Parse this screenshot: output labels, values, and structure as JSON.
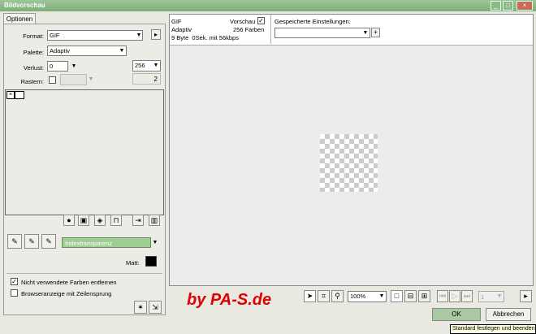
{
  "window": {
    "title": "Bildvorschau",
    "controls": [
      "minimize-icon",
      "maximize-icon",
      "close-icon"
    ]
  },
  "tabs": [
    {
      "label": "Optionen"
    }
  ],
  "options": {
    "format_label": "Format:",
    "format_value": "GIF",
    "palette_label": "Palette:",
    "palette_value": "Adaptiv",
    "loss_label": "Verlust:",
    "loss_value": "0",
    "colors_value": "256",
    "colors_sub": "2",
    "dither_label": "Rastern:"
  },
  "palette_toolbar": {
    "transparency_value": "Indextransparenz",
    "matte_label": "Matt:",
    "matte_color": "#000000"
  },
  "checkboxes": [
    {
      "label": "Nicht verwendete Farben entfernen",
      "checked": true
    },
    {
      "label": "Browseranzeige mit Zeilensprung",
      "checked": false
    }
  ],
  "preview_info": {
    "format": "GIF",
    "palette": "Adaptiv",
    "size_line": "9 Byte  0Sek. mit 56kbps",
    "preview_label": "Vorschau",
    "preview_checked": true,
    "colors_text": "256 Farben"
  },
  "saved_settings": {
    "label": "Gespeicherte Einstellungen:",
    "value": ""
  },
  "bottom_toolbar": {
    "zoom_value": "100%",
    "page_value": "1"
  },
  "buttons": {
    "ok": "OK",
    "cancel": "Abbrechen"
  },
  "tooltip": "Standard festlegen und beenden",
  "watermark": "by PA-S.de"
}
